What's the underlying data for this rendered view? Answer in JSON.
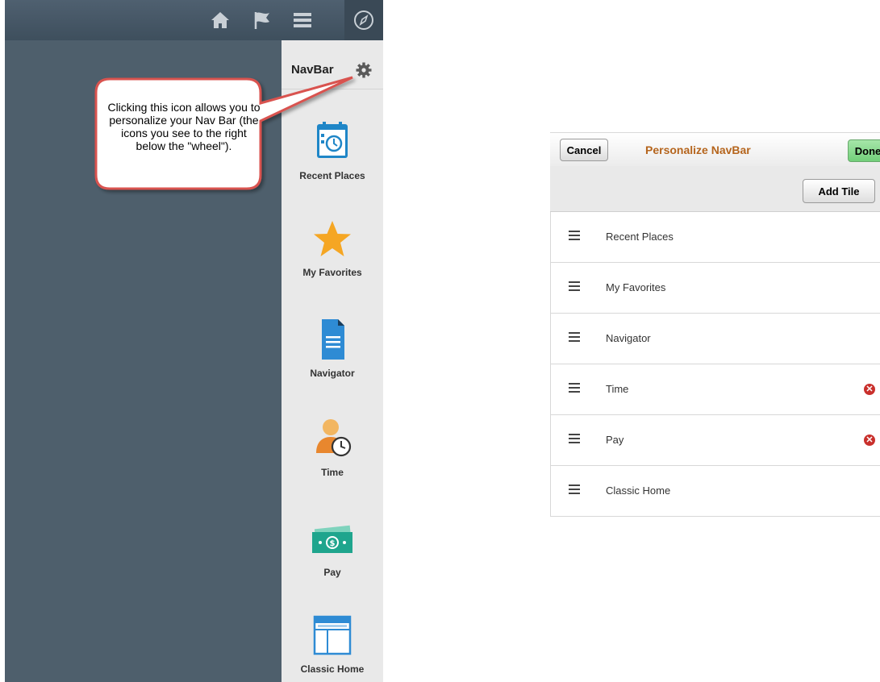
{
  "left_panel": {
    "top_icons": [
      {
        "name": "home-icon"
      },
      {
        "name": "flag-icon"
      },
      {
        "name": "menu-icon"
      },
      {
        "name": "compass-icon"
      }
    ],
    "navbar": {
      "title": "NavBar",
      "gear_icon": "gear-icon",
      "tiles": [
        {
          "label": "Recent Places",
          "icon": "calendar-clock-icon"
        },
        {
          "label": "My Favorites",
          "icon": "star-icon"
        },
        {
          "label": "Navigator",
          "icon": "document-icon"
        },
        {
          "label": "Time",
          "icon": "person-clock-icon"
        },
        {
          "label": "Pay",
          "icon": "money-icon"
        },
        {
          "label": "Classic Home",
          "icon": "window-icon"
        }
      ]
    },
    "callout": {
      "text": "Clicking this icon allows you to personalize your Nav Bar (the icons you see to the right below the \"wheel\")."
    }
  },
  "dialog": {
    "cancel_label": "Cancel",
    "title": "Personalize NavBar",
    "done_label": "Done",
    "add_tile_label": "Add Tile",
    "items": [
      {
        "label": "Recent Places",
        "removable": false
      },
      {
        "label": "My Favorites",
        "removable": false
      },
      {
        "label": "Navigator",
        "removable": false
      },
      {
        "label": "Time",
        "removable": true
      },
      {
        "label": "Pay",
        "removable": true
      },
      {
        "label": "Classic Home",
        "removable": false
      }
    ]
  },
  "colors": {
    "sidebar_bg": "#4e5f6c",
    "navbar_bg": "#e9e9e9",
    "title_accent": "#b5651d",
    "done_green": "#72cf7a",
    "remove_red": "#c9302c",
    "callout_border": "#d9534f"
  }
}
